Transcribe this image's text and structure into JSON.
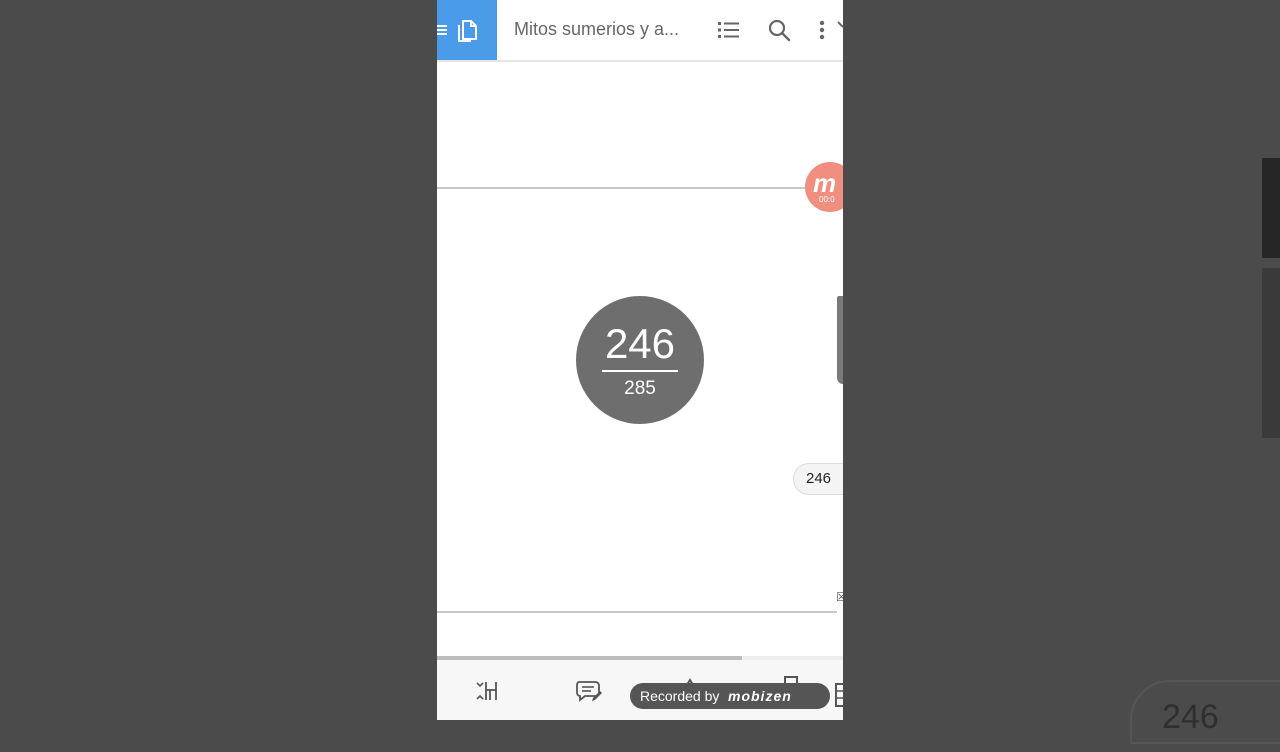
{
  "appbar": {
    "title": "Mitos sumerios y a...",
    "icons": [
      "menu-icon",
      "document-icon",
      "list-icon",
      "search-icon",
      "more-icon"
    ]
  },
  "recording_badge": {
    "letter": "m",
    "time": "00:0"
  },
  "page_counter": {
    "current": "246",
    "total": "285"
  },
  "page_tag": "246",
  "corner_mark": "☒",
  "progress": {
    "fraction": 0.75
  },
  "bottombar": {
    "icons": [
      "fit-width-icon",
      "comments-icon",
      "pen-icon",
      "bookmark-icon",
      "more-tools-icon"
    ],
    "recorded_by_label": "Recorded by",
    "recorder_brand": "mobizen"
  },
  "ghost": {
    "text": "246"
  },
  "colors": {
    "accent": "#4a9ce8",
    "counter_bg": "#6e6e6e",
    "badge": "#f08f7f"
  }
}
